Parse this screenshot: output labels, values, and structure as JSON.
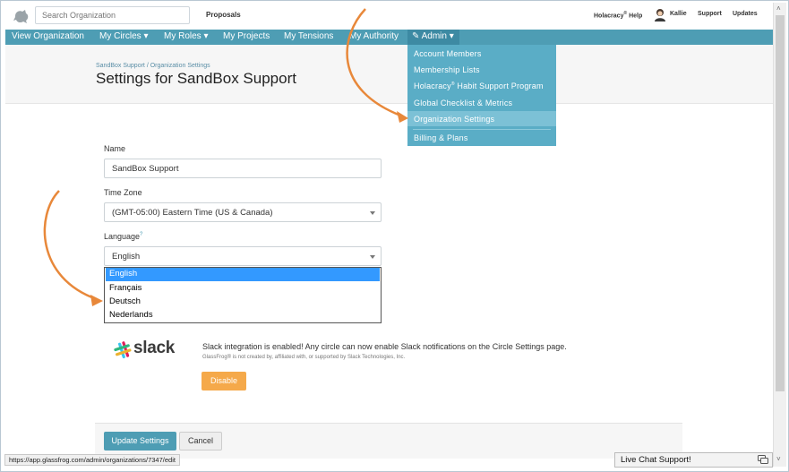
{
  "topbar": {
    "search_placeholder": "Search Organization",
    "proposals": "Proposals",
    "help_prefix": "Holacracy",
    "help_suffix": "Help",
    "user_name": "Kallie",
    "support": "Support",
    "updates": "Updates"
  },
  "nav": {
    "items": [
      "View Organization",
      "My Circles ▾",
      "My Roles ▾",
      "My Projects",
      "My Tensions",
      "My Authority"
    ],
    "admin": "Admin ▾",
    "admin_menu": [
      "Account Members",
      "Membership Lists",
      "Habit Support Program",
      "Global Checklist & Metrics",
      "Organization Settings",
      "Billing & Plans"
    ],
    "admin_menu_prefix": "Holacracy"
  },
  "header": {
    "breadcrumb": "SandBox Support / Organization Settings",
    "title": "Settings for SandBox Support"
  },
  "form": {
    "name_label": "Name",
    "name_value": "SandBox Support",
    "timezone_label": "Time Zone",
    "timezone_value": "(GMT-05:00) Eastern Time (US & Canada)",
    "language_label": "Language",
    "language_help": "?",
    "language_value": "English",
    "language_options": [
      "English",
      "Français",
      "Deutsch",
      "Nederlands"
    ]
  },
  "slack": {
    "word": "slack",
    "message": "Slack integration is enabled! Any circle can now enable Slack notifications on the Circle Settings page.",
    "disclaimer": "GlassFrog® is not created by, affiliated with, or supported by Slack Technologies, Inc.",
    "disable_label": "Disable"
  },
  "actions": {
    "update_label": "Update Settings",
    "cancel_label": "Cancel"
  },
  "status": {
    "url": "https://app.glassfrog.com/admin/organizations/7347/edit"
  },
  "chat": {
    "label": "Live Chat Support!"
  },
  "colors": {
    "nav": "#4e9db4",
    "menu": "#5aadc6",
    "accent_orange": "#f5a94a",
    "arrow": "#e8883a"
  }
}
